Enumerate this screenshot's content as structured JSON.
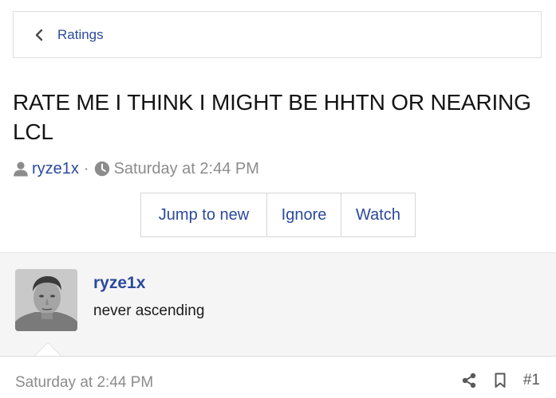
{
  "breadcrumb": {
    "label": "Ratings",
    "icon": "chevron-left-icon"
  },
  "thread": {
    "title": "RATE ME I THINK I MIGHT BE HHTN OR NEARING LCL",
    "author": "ryze1x",
    "separator": "·",
    "date": "Saturday at 2:44 PM"
  },
  "actions": {
    "jump_label": "Jump to new",
    "ignore_label": "Ignore",
    "watch_label": "Watch"
  },
  "post": {
    "username": "ryze1x",
    "tagline": "never ascending",
    "date": "Saturday at 2:44 PM",
    "number": "#1"
  },
  "colors": {
    "link": "#2b4a9c",
    "muted": "#8c8c8c",
    "post_bg": "#f5f5f5"
  }
}
